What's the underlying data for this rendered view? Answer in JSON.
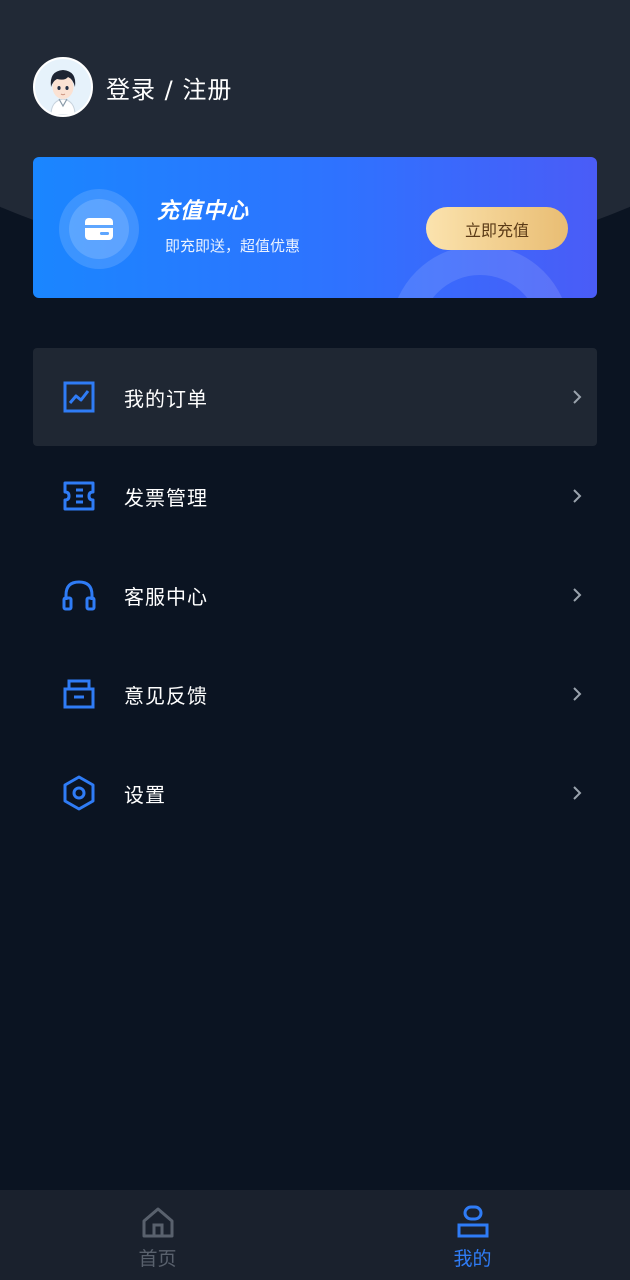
{
  "profile": {
    "login_label": "登录 / 注册",
    "avatar_icon": "user-avatar-icon"
  },
  "recharge": {
    "title": "充值中心",
    "subtitle": "即充即送，超值优惠",
    "button_label": "立即充值",
    "icon": "card-icon"
  },
  "menu": {
    "items": [
      {
        "label": "我的订单",
        "icon": "chart-icon"
      },
      {
        "label": "发票管理",
        "icon": "ticket-icon"
      },
      {
        "label": "客服中心",
        "icon": "headset-icon"
      },
      {
        "label": "意见反馈",
        "icon": "inbox-icon"
      },
      {
        "label": "设置",
        "icon": "hexagon-settings-icon"
      }
    ]
  },
  "bottom_nav": {
    "tabs": [
      {
        "label": "首页",
        "icon": "home-icon",
        "active": false
      },
      {
        "label": "我的",
        "icon": "user-icon",
        "active": true
      }
    ]
  },
  "colors": {
    "background": "#0b1422",
    "header": "#212936",
    "accent": "#2f7cf6",
    "card_gradient_start": "#1a86ff",
    "card_gradient_end": "#4a5cf7",
    "button_gold": "#e9bd73"
  }
}
